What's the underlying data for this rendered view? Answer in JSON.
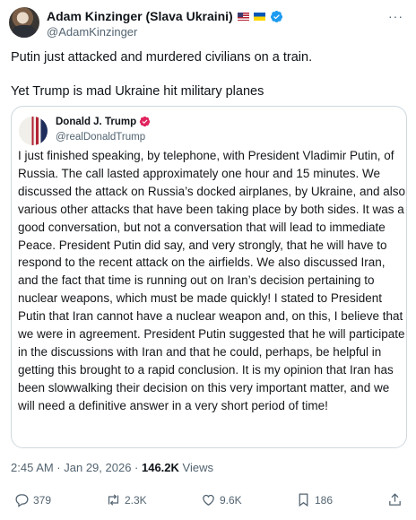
{
  "author": {
    "display_name": "Adam Kinzinger (Slava Ukraini)",
    "handle": "@AdamKinzinger"
  },
  "tweet": {
    "lines": [
      "Putin just attacked and murdered civilians on a train.",
      "Yet Trump is mad Ukraine hit military planes"
    ]
  },
  "quote": {
    "display_name": "Donald J. Trump",
    "handle": "@realDonaldTrump",
    "text": "I just finished speaking, by telephone, with President Vladimir Putin, of Russia. The call lasted approximately one hour and 15 minutes. We discussed the attack on Russia’s docked airplanes, by Ukraine, and also various other attacks that have been taking place by both sides. It was a good conversation, but not a conversation that will lead to immediate Peace. President Putin did say, and very strongly, that he will have to respond to the recent attack on the airfields. We also discussed Iran, and the fact that time is running out on Iran’s decision pertaining to nuclear weapons, which must be made quickly! I stated to President Putin that Iran cannot have a nuclear weapon and, on this, I believe that we were in agreement. President Putin suggested that he will participate in the discussions with Iran and that he could, perhaps, be helpful in getting this brought to a rapid conclusion. It is my opinion that Iran has been slowwalking their decision on this very important matter, and we will need a definitive answer in a very short period of time!"
  },
  "meta": {
    "timestamp": "2:45 AM · Jan 29, 2026 · ",
    "views_count": "146.2K",
    "views_label": " Views"
  },
  "actions": {
    "replies": "379",
    "reposts": "2.3K",
    "likes": "9.6K",
    "bookmarks": "186"
  },
  "colors": {
    "verified_blue": "#1d9bf0",
    "verified_pink": "#e0245e",
    "secondary_text": "#536471"
  },
  "icons": [
    "more-icon",
    "reply-icon",
    "repost-icon",
    "like-icon",
    "bookmark-icon",
    "share-icon",
    "verified-badge-icon"
  ]
}
